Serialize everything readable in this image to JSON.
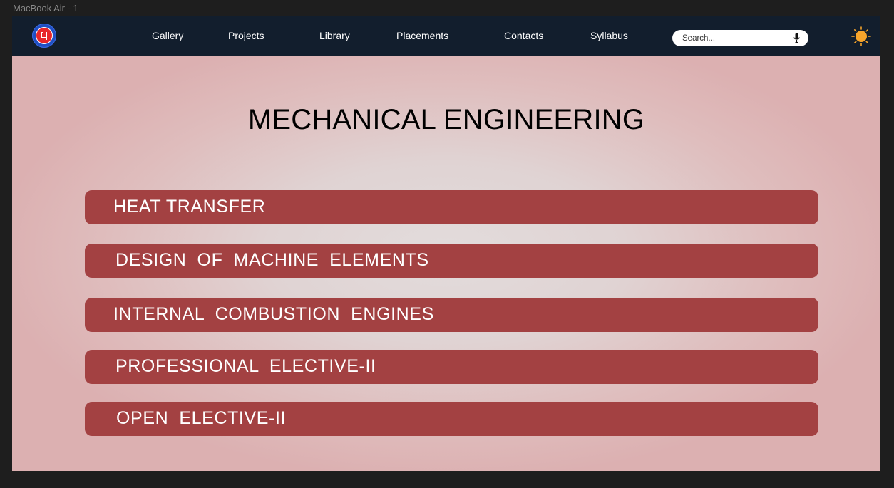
{
  "canvas": {
    "frame_label": "MacBook Air - 1"
  },
  "navbar": {
    "logo_icon": "college-logo-icon",
    "links": [
      {
        "label": "Gallery"
      },
      {
        "label": "Projects"
      },
      {
        "label": "Library"
      },
      {
        "label": "Placements"
      },
      {
        "label": "Contacts"
      },
      {
        "label": "Syllabus"
      }
    ],
    "search": {
      "placeholder": "Search...",
      "value": "",
      "icon": "microphone-icon"
    },
    "theme_icon": "sun-icon",
    "colors": {
      "background": "#121e2d",
      "text": "#ffffff"
    }
  },
  "main": {
    "title": "MECHANICAL ENGINEERING",
    "subjects": [
      {
        "label": "HEAT TRANSFER"
      },
      {
        "label": "DESIGN  OF  MACHINE  ELEMENTS"
      },
      {
        "label": "INTERNAL  COMBUSTION  ENGINES"
      },
      {
        "label": "PROFESSIONAL  ELECTIVE-II"
      },
      {
        "label": "OPEN  ELECTIVE-II"
      }
    ],
    "colors": {
      "bar": "#a34142",
      "bar_text": "#ffffff",
      "background_center": "#e2dcdc",
      "background_edge": "#dcb0b1"
    }
  }
}
